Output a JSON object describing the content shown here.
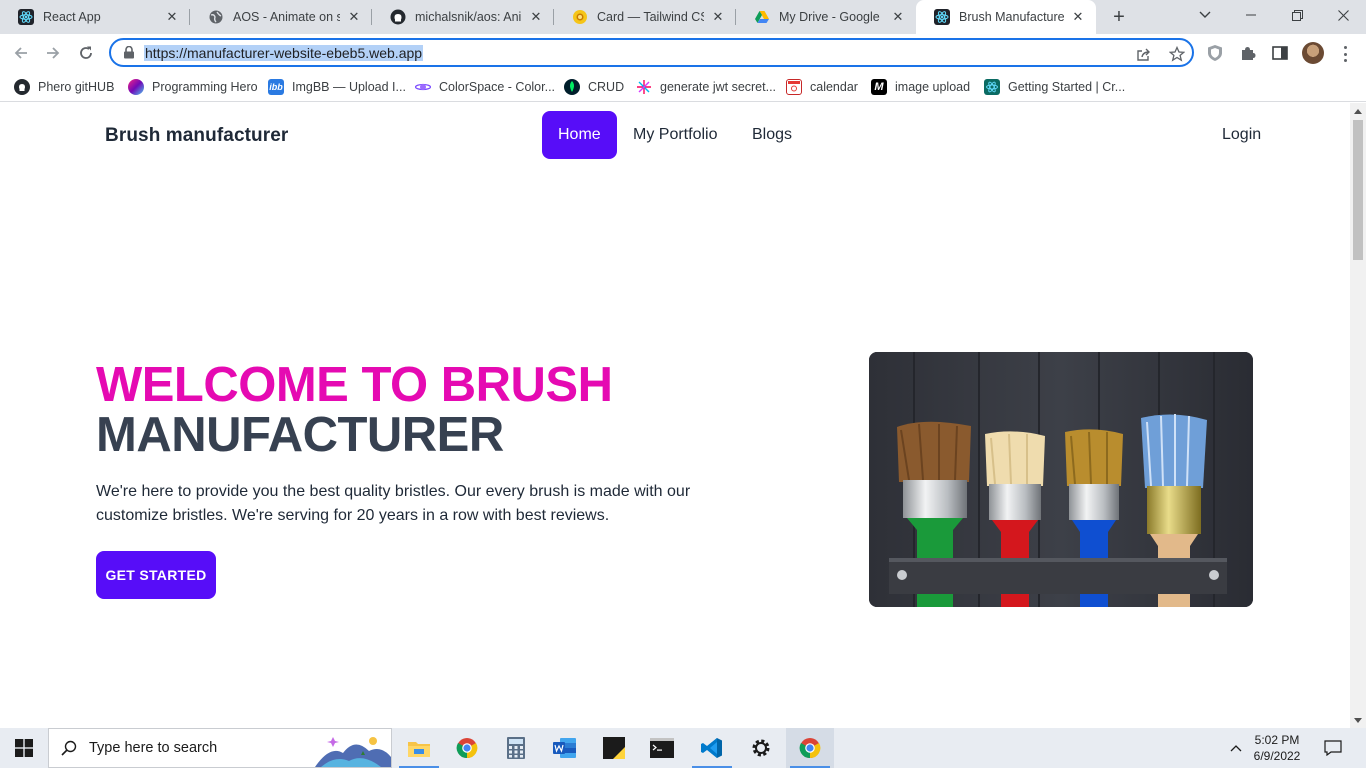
{
  "browser": {
    "tabs": [
      {
        "title": "React App",
        "icon": "react-icon",
        "active": false
      },
      {
        "title": "AOS - Animate on scroll",
        "icon": "globe-icon",
        "active": false
      },
      {
        "title": "michalsnik/aos: Animate",
        "icon": "github-icon",
        "active": false
      },
      {
        "title": "Card — Tailwind CSS Com",
        "icon": "daisyui-icon",
        "active": false
      },
      {
        "title": "My Drive - Google Drive",
        "icon": "google-drive-icon",
        "active": false
      },
      {
        "title": "Brush Manufacturer",
        "icon": "react-icon",
        "active": true
      }
    ],
    "url": "https://manufacturer-website-ebeb5.web.app",
    "bookmarks": [
      {
        "label": "Phero gitHUB",
        "icon": "github-icon"
      },
      {
        "label": "Programming Hero",
        "icon": "programming-hero-icon"
      },
      {
        "label": "ImgBB — Upload I...",
        "icon": "imgbb-icon"
      },
      {
        "label": "ColorSpace - Color...",
        "icon": "colorspace-icon"
      },
      {
        "label": "CRUD",
        "icon": "mongodb-leaf-icon"
      },
      {
        "label": "generate jwt secret...",
        "icon": "jwt-icon"
      },
      {
        "label": "calendar",
        "icon": "calendar-icon"
      },
      {
        "label": "image upload",
        "icon": "medium-icon"
      },
      {
        "label": "Getting Started | Cr...",
        "icon": "react-icon"
      }
    ]
  },
  "site": {
    "brand": "Brush manufacturer",
    "nav": {
      "home": "Home",
      "portfolio": "My Portfolio",
      "blogs": "Blogs",
      "login": "Login"
    },
    "hero": {
      "title_line1": "WELCOME TO BRUSH",
      "title_line2": "MANUFACTURER",
      "text": "We're here to provide you the best quality bristles. Our every brush is made with our customize bristles. We're serving for 20 years in a row with best reviews.",
      "cta": "GET STARTED",
      "image_alt": "paint brushes on a dark wooden rack"
    },
    "colors": {
      "primary": "#570df8",
      "accent": "#e50ab2",
      "heading": "#374151"
    }
  },
  "taskbar": {
    "search_placeholder": "Type here to search",
    "time": "5:02 PM",
    "date": "6/9/2022"
  }
}
